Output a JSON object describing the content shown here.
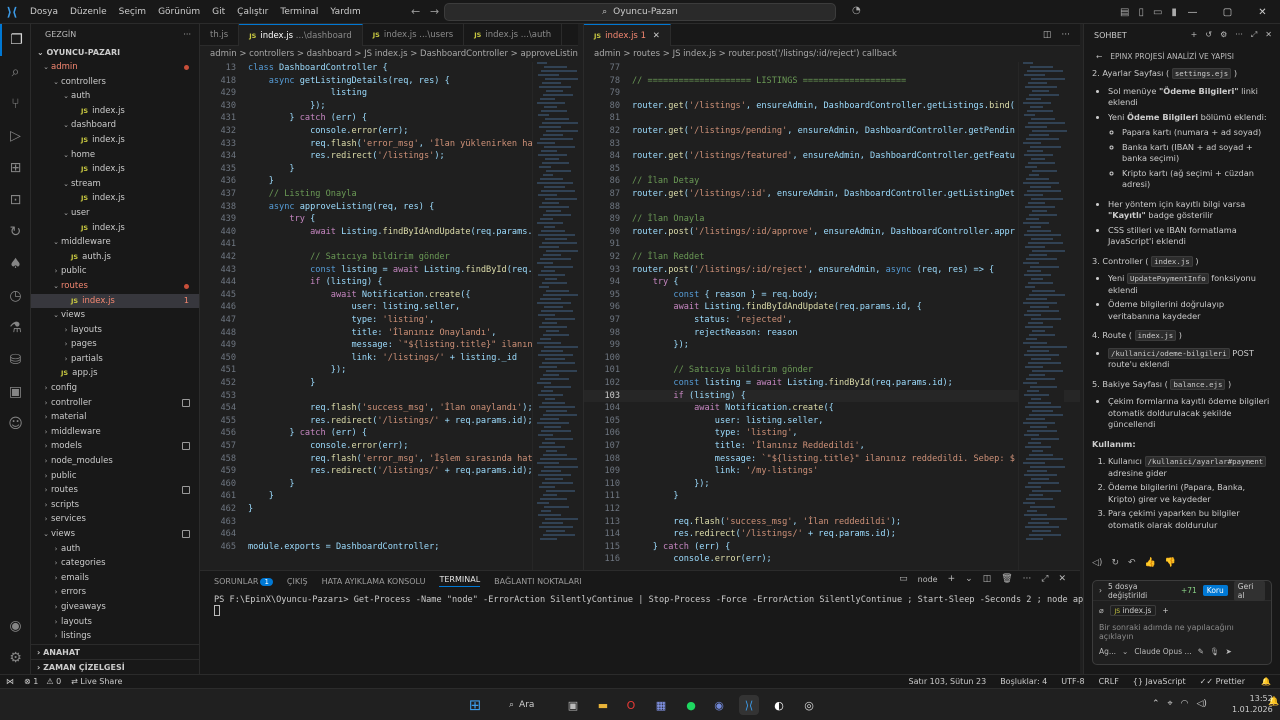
{
  "titlebar": {
    "menus": [
      "Dosya",
      "Düzenle",
      "Seçim",
      "Görünüm",
      "Git",
      "Çalıştır",
      "Terminal",
      "Yardım"
    ],
    "search": "Oyuncu-Pazarı"
  },
  "explorer": {
    "header": "GEZGİN",
    "root": "OYUNCU-PAZARI",
    "items": [
      {
        "label": "admin",
        "depth": 0,
        "type": "folder",
        "open": true,
        "err": true,
        "badge": "dot"
      },
      {
        "label": "controllers",
        "depth": 1,
        "type": "folder",
        "open": true
      },
      {
        "label": "auth",
        "depth": 2,
        "type": "folder",
        "open": true
      },
      {
        "label": "index.js",
        "depth": 3,
        "type": "js"
      },
      {
        "label": "dashboard",
        "depth": 2,
        "type": "folder",
        "open": true
      },
      {
        "label": "index.js",
        "depth": 3,
        "type": "js"
      },
      {
        "label": "home",
        "depth": 2,
        "type": "folder",
        "open": true
      },
      {
        "label": "index.js",
        "depth": 3,
        "type": "js"
      },
      {
        "label": "stream",
        "depth": 2,
        "type": "folder",
        "open": true
      },
      {
        "label": "index.js",
        "depth": 3,
        "type": "js"
      },
      {
        "label": "user",
        "depth": 2,
        "type": "folder",
        "open": true
      },
      {
        "label": "index.js",
        "depth": 3,
        "type": "js"
      },
      {
        "label": "middleware",
        "depth": 1,
        "type": "folder",
        "open": true
      },
      {
        "label": "auth.js",
        "depth": 2,
        "type": "js"
      },
      {
        "label": "public",
        "depth": 1,
        "type": "folder",
        "open": false
      },
      {
        "label": "routes",
        "depth": 1,
        "type": "folder",
        "open": true,
        "err": true,
        "badge": "dot"
      },
      {
        "label": "index.js",
        "depth": 2,
        "type": "js",
        "err": true,
        "selected": true,
        "badge": "1"
      },
      {
        "label": "views",
        "depth": 1,
        "type": "folder",
        "open": true
      },
      {
        "label": "layouts",
        "depth": 2,
        "type": "folder",
        "open": false
      },
      {
        "label": "pages",
        "depth": 2,
        "type": "folder",
        "open": false
      },
      {
        "label": "partials",
        "depth": 2,
        "type": "folder",
        "open": false
      },
      {
        "label": "app.js",
        "depth": 1,
        "type": "js"
      },
      {
        "label": "config",
        "depth": 0,
        "type": "folder",
        "open": false
      },
      {
        "label": "controller",
        "depth": 0,
        "type": "folder",
        "open": false,
        "badge": "sq"
      },
      {
        "label": "material",
        "depth": 0,
        "type": "folder",
        "open": false
      },
      {
        "label": "middleware",
        "depth": 0,
        "type": "folder",
        "open": false
      },
      {
        "label": "models",
        "depth": 0,
        "type": "folder",
        "open": false,
        "badge": "sq"
      },
      {
        "label": "node_modules",
        "depth": 0,
        "type": "folder",
        "open": false
      },
      {
        "label": "public",
        "depth": 0,
        "type": "folder",
        "open": false
      },
      {
        "label": "routes",
        "depth": 0,
        "type": "folder",
        "open": false,
        "badge": "sq"
      },
      {
        "label": "scripts",
        "depth": 0,
        "type": "folder",
        "open": false
      },
      {
        "label": "services",
        "depth": 0,
        "type": "folder",
        "open": false
      },
      {
        "label": "views",
        "depth": 0,
        "type": "folder",
        "open": true,
        "badge": "sq"
      },
      {
        "label": "auth",
        "depth": 1,
        "type": "folder",
        "open": false
      },
      {
        "label": "categories",
        "depth": 1,
        "type": "folder",
        "open": false
      },
      {
        "label": "emails",
        "depth": 1,
        "type": "folder",
        "open": false
      },
      {
        "label": "errors",
        "depth": 1,
        "type": "folder",
        "open": false
      },
      {
        "label": "giveaways",
        "depth": 1,
        "type": "folder",
        "open": false
      },
      {
        "label": "layouts",
        "depth": 1,
        "type": "folder",
        "open": false
      },
      {
        "label": "listings",
        "depth": 1,
        "type": "folder",
        "open": false
      }
    ],
    "outline": "ANAHAT",
    "timeline": "ZAMAN ÇİZELGESİ"
  },
  "left_editor": {
    "tabs": [
      {
        "label": "th.js",
        "js": false
      },
      {
        "label": "index.js",
        "hint": "...\\dashboard",
        "active": true
      },
      {
        "label": "index.js",
        "hint": "...\\users"
      },
      {
        "label": "index.js",
        "hint": "...\\auth"
      }
    ],
    "breadcrumb": "admin > controllers > dashboard > JS index.js > DashboardController > approveListing",
    "lines": [
      {
        "n": "13",
        "t": "class DashboardController {"
      },
      {
        "n": "418",
        "t": "    async getListingDetails(req, res) {"
      },
      {
        "n": "429",
        "t": "                listing"
      },
      {
        "n": "430",
        "t": "            });"
      },
      {
        "n": "431",
        "t": "        } catch (err) {"
      },
      {
        "n": "432",
        "t": "            console.error(err);"
      },
      {
        "n": "433",
        "t": "            req.flash('error_msg', 'İlan yüklenirken ha"
      },
      {
        "n": "434",
        "t": "            res.redirect('/listings');"
      },
      {
        "n": "435",
        "t": "        }"
      },
      {
        "n": "436",
        "t": "    }"
      },
      {
        "n": "437",
        "t": "    // Listing Onayla"
      },
      {
        "n": "438",
        "t": "    async approveListing(req, res) {"
      },
      {
        "n": "439",
        "t": "        try {"
      },
      {
        "n": "440",
        "t": "            await Listing.findByIdAndUpdate(req.params."
      },
      {
        "n": "441",
        "t": ""
      },
      {
        "n": "442",
        "t": "            // Satıcıya bildirim gönder"
      },
      {
        "n": "443",
        "t": "            const listing = await Listing.findById(req."
      },
      {
        "n": "444",
        "t": "            if (listing) {"
      },
      {
        "n": "445",
        "t": "                await Notification.create({"
      },
      {
        "n": "446",
        "t": "                    user: listing.seller,"
      },
      {
        "n": "447",
        "t": "                    type: 'listing',"
      },
      {
        "n": "448",
        "t": "                    title: 'İlanınız Onaylandı',"
      },
      {
        "n": "449",
        "t": "                    message: `\"${listing.title}\" ilanın"
      },
      {
        "n": "450",
        "t": "                    link: '/listings/' + listing._id"
      },
      {
        "n": "451",
        "t": "                });"
      },
      {
        "n": "452",
        "t": "            }"
      },
      {
        "n": "453",
        "t": ""
      },
      {
        "n": "454",
        "t": "            req.flash('success_msg', 'İlan onaylandı');"
      },
      {
        "n": "455",
        "t": "            res.redirect('/listings/' + req.params.id);"
      },
      {
        "n": "456",
        "t": "        } catch (err) {"
      },
      {
        "n": "457",
        "t": "            console.error(err);"
      },
      {
        "n": "458",
        "t": "            req.flash('error_msg', 'İşlem sırasında hat"
      },
      {
        "n": "459",
        "t": "            res.redirect('/listings/' + req.params.id);"
      },
      {
        "n": "460",
        "t": "        }"
      },
      {
        "n": "461",
        "t": "    }"
      },
      {
        "n": "462",
        "t": "}"
      },
      {
        "n": "463",
        "t": ""
      },
      {
        "n": "464",
        "t": ""
      },
      {
        "n": "465",
        "t": "module.exports = DashboardController;"
      }
    ]
  },
  "right_editor": {
    "tabs": [
      {
        "label": "index.js",
        "badge": "1",
        "active": true
      }
    ],
    "breadcrumb": "admin > routes > JS index.js > router.post('/listings/:id/reject') callback",
    "lines": [
      {
        "n": "77",
        "t": ""
      },
      {
        "n": "78",
        "t": "// ==================== LISTINGS ===================="
      },
      {
        "n": "79",
        "t": ""
      },
      {
        "n": "80",
        "t": "router.get('/listings', ensureAdmin, DashboardController.getListings.bind("
      },
      {
        "n": "81",
        "t": ""
      },
      {
        "n": "82",
        "t": "router.get('/listings/pending', ensureAdmin, DashboardController.getPendin"
      },
      {
        "n": "83",
        "t": ""
      },
      {
        "n": "84",
        "t": "router.get('/listings/featured', ensureAdmin, DashboardController.getFeatu"
      },
      {
        "n": "85",
        "t": ""
      },
      {
        "n": "86",
        "t": "// İlan Detay"
      },
      {
        "n": "87",
        "t": "router.get('/listings/:id', ensureAdmin, DashboardController.getListingDet"
      },
      {
        "n": "88",
        "t": ""
      },
      {
        "n": "89",
        "t": "// İlan Onayla"
      },
      {
        "n": "90",
        "t": "router.post('/listings/:id/approve', ensureAdmin, DashboardController.appr"
      },
      {
        "n": "91",
        "t": ""
      },
      {
        "n": "92",
        "t": "// İlan Reddet"
      },
      {
        "n": "93",
        "t": "router.post('/listings/:id/reject', ensureAdmin, async (req, res) => {"
      },
      {
        "n": "94",
        "t": "    try {"
      },
      {
        "n": "95",
        "t": "        const { reason } = req.body;"
      },
      {
        "n": "96",
        "t": "        await Listing.findByIdAndUpdate(req.params.id, {"
      },
      {
        "n": "97",
        "t": "            status: 'rejected',"
      },
      {
        "n": "98",
        "t": "            rejectReason: reason"
      },
      {
        "n": "99",
        "t": "        });"
      },
      {
        "n": "100",
        "t": ""
      },
      {
        "n": "101",
        "t": "        // Satıcıya bildirim gönder"
      },
      {
        "n": "102",
        "t": "        const listing = await Listing.findById(req.params.id);"
      },
      {
        "n": "103",
        "t": "        if (listing) {",
        "current": true
      },
      {
        "n": "104",
        "t": "            await Notification.create({"
      },
      {
        "n": "105",
        "t": "                user: listing.seller,"
      },
      {
        "n": "106",
        "t": "                type: 'listing',"
      },
      {
        "n": "107",
        "t": "                title: 'İlanınız Reddedildi',"
      },
      {
        "n": "108",
        "t": "                message: `\"${listing.title}\" ilanınız reddedildi. Sebep: $"
      },
      {
        "n": "109",
        "t": "                link: '/my-listings'"
      },
      {
        "n": "110",
        "t": "            });"
      },
      {
        "n": "111",
        "t": "        }"
      },
      {
        "n": "112",
        "t": ""
      },
      {
        "n": "113",
        "t": "        req.flash('success_msg', 'İlan reddedildi');"
      },
      {
        "n": "114",
        "t": "        res.redirect('/listings/' + req.params.id);"
      },
      {
        "n": "115",
        "t": "    } catch (err) {"
      },
      {
        "n": "116",
        "t": "        console.error(err);"
      }
    ]
  },
  "panel": {
    "tabs": [
      "SORUNLAR",
      "ÇIKIŞ",
      "HATA AYIKLAMA KONSOLU",
      "TERMINAL",
      "BAĞLANTI NOKTALARI"
    ],
    "problems_count": "1",
    "active_tab": "TERMINAL",
    "shell": "node",
    "terminal_line": "PS F:\\EpinX\\Oyuncu-Pazarı> Get-Process -Name \"node\" -ErrorAction SilentlyContinue | Stop-Process -Force -ErrorAction SilentlyContinue ; Start-Sleep -Seconds 2 ; node app.js"
  },
  "chat": {
    "header": "SOHBET",
    "subtitle": "EPINX PROJESİ ANALİZİ VE YAPISI",
    "s2_title": "2. Ayarlar Sayfası (",
    "s2_file": "settings.ejs",
    "s2_b1_pre": "Sol menüye ",
    "s2_b1_bold": "\"Ödeme Bilgileri\"",
    "s2_b1_post": " linki eklendi",
    "s2_b2_pre": "Yeni ",
    "s2_b2_bold": "Ödeme Bilgileri",
    "s2_b2_post": " bölümü eklendi:",
    "s2_sub": [
      "Papara kartı (numara + ad soyad)",
      "Banka kartı (IBAN + ad soyad + banka seçimi)",
      "Kripto kartı (ağ seçimi + cüzdan adresi)"
    ],
    "s2_b3_pre": "Her yöntem için kayıtlı bilgi varsa ",
    "s2_b3_bold": "\"Kayıtlı\"",
    "s2_b3_post": " badge gösterilir",
    "s2_b4": "CSS stilleri ve IBAN formatlama JavaScript'i eklendi",
    "s3_title": "3. Controller (",
    "s3_file": "index.js",
    "s3_b1_pre": "Yeni ",
    "s3_b1_code": "UpdatePaymentInfo",
    "s3_b1_post": " fonksiyonu eklendi",
    "s3_b2": "Ödeme bilgilerini doğrulayıp veritabanına kaydeder",
    "s4_title": "4. Route (",
    "s4_file": "index.js",
    "s4_b1_code": "/kullanici/odeme-bilgileri",
    "s4_b1_post": " POST route'u eklendi",
    "s5_title": "5. Bakiye Sayfası (",
    "s5_file": "balance.ejs",
    "s5_b1": "Çekim formlarına kayıtlı ödeme bilgileri otomatik doldurulacak şekilde güncellendi",
    "usage_title": "Kullanım:",
    "u1_pre": "Kullanıcı ",
    "u1_code": "/kullanici/ayarlar#payment",
    "u1_post": " adresine gider",
    "u2": "Ödeme bilgilerini (Papara, Banka, Kripto) girer ve kaydeder",
    "u3": "Para çekimi yaparken bu bilgiler otomatik olarak doldurulur",
    "changes": "5 dosya değiştirildi",
    "changes_count": "+71",
    "keep": "Koru",
    "undo": "Geri al",
    "context_file": "index.js",
    "input_placeholder": "Bir sonraki adımda ne yapılacağını açıklayın",
    "mode": "Ag...",
    "model": "Claude Opus ..."
  },
  "statusbar": {
    "errors": "1",
    "warnings": "0",
    "live_share": "Live Share",
    "position": "Satır 103, Sütun 23",
    "spaces": "Boşluklar: 4",
    "encoding": "UTF-8",
    "eol": "CRLF",
    "language": "JavaScript",
    "prettier": "Prettier"
  },
  "taskbar": {
    "search": "Ara",
    "time": "13:52",
    "date": "1.01.2026"
  }
}
